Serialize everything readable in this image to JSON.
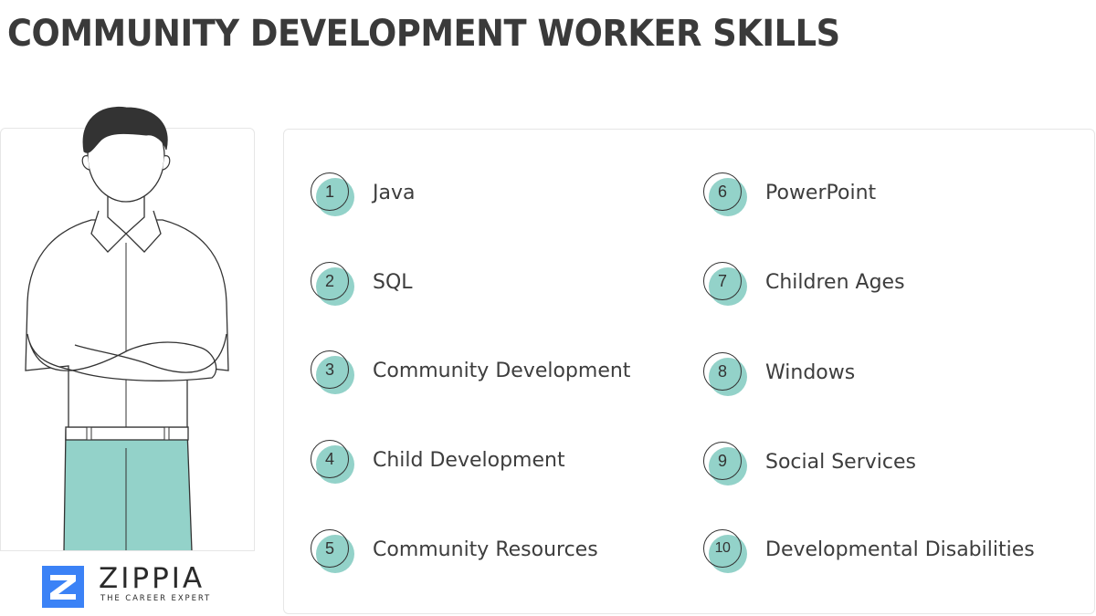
{
  "title": "COMMUNITY DEVELOPMENT WORKER SKILLS",
  "colors": {
    "accent": "#93d2c9",
    "text": "#3d3d3d",
    "logo_blue": "#3b82f6"
  },
  "skills_left": [
    {
      "number": "1",
      "label": "Java"
    },
    {
      "number": "2",
      "label": "SQL"
    },
    {
      "number": "3",
      "label": "Community Development"
    },
    {
      "number": "4",
      "label": "Child Development"
    },
    {
      "number": "5",
      "label": "Community Resources"
    }
  ],
  "skills_right": [
    {
      "number": "6",
      "label": "PowerPoint"
    },
    {
      "number": "7",
      "label": "Children Ages"
    },
    {
      "number": "8",
      "label": "Windows"
    },
    {
      "number": "9",
      "label": "Social Services"
    },
    {
      "number": "10",
      "label": "Developmental Disabilities"
    }
  ],
  "logo": {
    "name": "ZIPPIA",
    "tagline": "THE CAREER EXPERT",
    "icon": "zippia-logo-icon"
  },
  "illustration": {
    "icon": "person-arms-crossed-icon"
  }
}
